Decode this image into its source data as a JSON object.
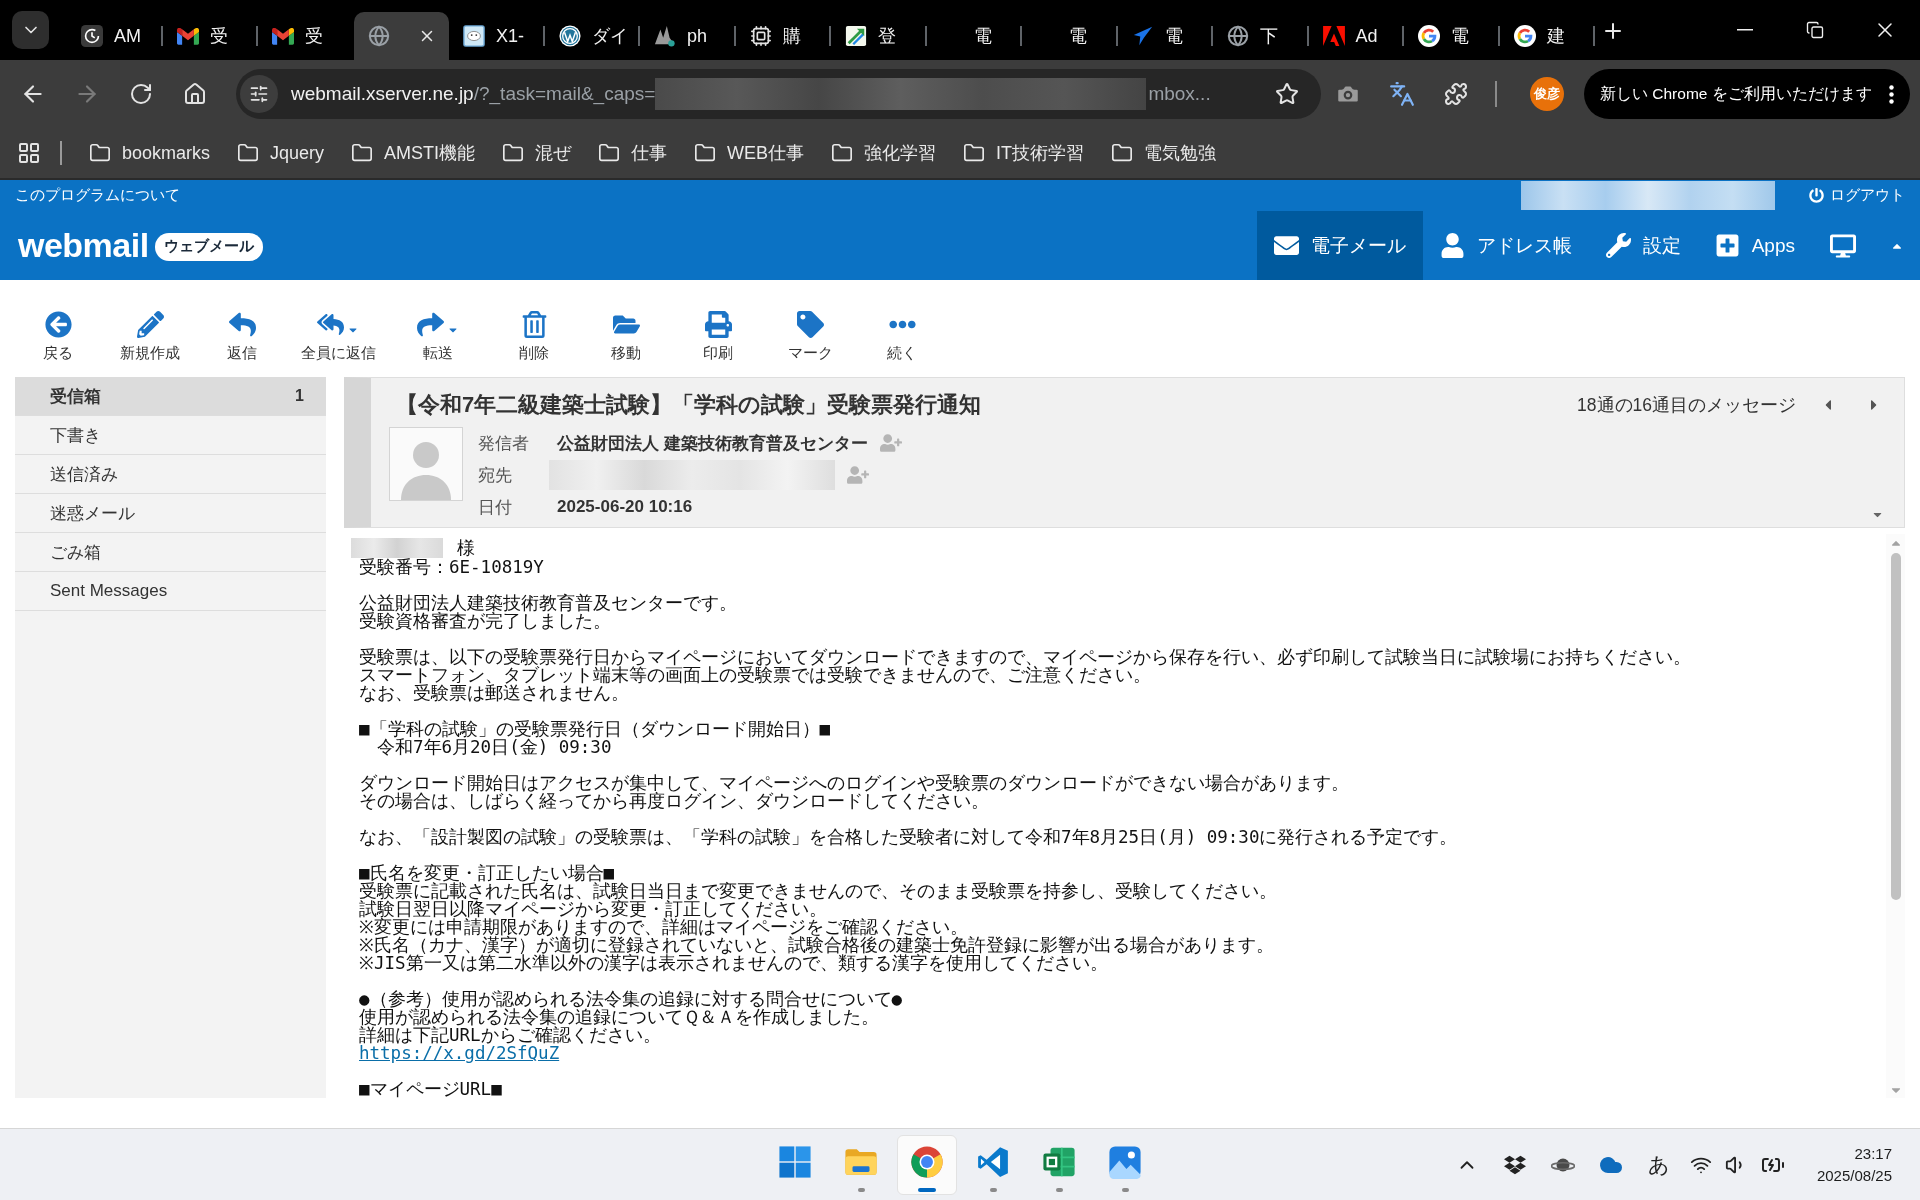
{
  "browser": {
    "tabs": [
      {
        "title": "AM",
        "selected": false
      },
      {
        "title": "受",
        "selected": false
      },
      {
        "title": "受",
        "selected": false
      },
      {
        "selected": true
      },
      {
        "title": "X1-",
        "selected": false
      },
      {
        "title": "ダイ",
        "selected": false
      },
      {
        "title": "ph",
        "selected": false
      },
      {
        "title": "購",
        "selected": false
      },
      {
        "title": "登",
        "selected": false
      },
      {
        "title": "電",
        "selected": false
      },
      {
        "title": "電",
        "selected": false
      },
      {
        "title": "電",
        "selected": false
      },
      {
        "title": "下",
        "selected": false
      },
      {
        "title": "Ad",
        "selected": false
      },
      {
        "title": "電",
        "selected": false
      },
      {
        "title": "建",
        "selected": false
      }
    ],
    "forward_button": {
      "disabled": true
    },
    "address_bar": {
      "host": "webmail.xserver.ne.jp",
      "path": "/?_task=mail&_caps=",
      "tail": "mbox..."
    },
    "profile_initials": "俊彦",
    "update_button": "新しい Chrome をご利用いただけます",
    "bookmarks": [
      "bookmarks",
      "Jquery",
      "AMSTI機能",
      "混ぜ",
      "仕事",
      "WEB仕事",
      "強化学習",
      "IT技術学習",
      "電気勉強"
    ]
  },
  "webmail": {
    "about_link": "このプログラムについて",
    "logout": "ログアウト",
    "logo": {
      "name": "webmail",
      "badge": "ウェブメール"
    },
    "nav": [
      {
        "label": "電子メール",
        "selected": true
      },
      {
        "label": "アドレス帳",
        "selected": false
      },
      {
        "label": "設定",
        "selected": false
      },
      {
        "label": "Apps",
        "selected": false
      }
    ],
    "toolbar": [
      {
        "label": "戻る",
        "dropdown": false
      },
      {
        "label": "新規作成",
        "dropdown": false
      },
      {
        "label": "返信",
        "dropdown": false
      },
      {
        "label": "全員に返信",
        "dropdown": true
      },
      {
        "label": "転送",
        "dropdown": true
      },
      {
        "label": "削除",
        "dropdown": false
      },
      {
        "label": "移動",
        "dropdown": false
      },
      {
        "label": "印刷",
        "dropdown": false
      },
      {
        "label": "マーク",
        "dropdown": false
      },
      {
        "label": "続く",
        "dropdown": false
      }
    ],
    "folders": [
      {
        "name": "受信箱",
        "count": "1",
        "selected": true
      },
      {
        "name": "下書き",
        "selected": false
      },
      {
        "name": "送信済み",
        "selected": false
      },
      {
        "name": "迷惑メール",
        "selected": false
      },
      {
        "name": "ごみ箱",
        "selected": false
      },
      {
        "name": "Sent Messages",
        "selected": false
      }
    ],
    "message": {
      "subject": "【令和7年二級建築士試験】「学科の試験」受験票発行通知",
      "position": "18通の16通目のメッセージ",
      "from": {
        "label": "発信者",
        "value": "公益財団法人 建築技術教育普及センター"
      },
      "to": {
        "label": "宛先"
      },
      "date": {
        "label": "日付",
        "value": "2025-06-20 10:16"
      },
      "body": {
        "salutation": "様",
        "paragraphs": [
          {
            "lines": [
              "受験番号：6E-10819Y"
            ]
          },
          {
            "lines": [
              "公益財団法人建築技術教育普及センターです。",
              "受験資格審査が完了しました。"
            ]
          },
          {
            "lines": [
              "受験票は、以下の受験票発行日からマイページにおいてダウンロードできますので、マイページから保存を行い、必ず印刷して試験当日に試験場にお持ちください。",
              "スマートフォン、タブレット端末等の画面上の受験票では受験できませんので、ご注意ください。",
              "なお、受験票は郵送されません。"
            ]
          },
          {
            "lines": [
              "■「学科の試験」の受験票発行日（ダウンロード開始日）■",
              "　令和7年6月20日(金) 09:30"
            ]
          },
          {
            "lines": [
              "ダウンロード開始日はアクセスが集中して、マイページへのログインや受験票のダウンロードができない場合があります。",
              "その場合は、しばらく経ってから再度ログイン、ダウンロードしてください。"
            ]
          },
          {
            "lines": [
              "なお、「設計製図の試験」の受験票は、「学科の試験」を合格した受験者に対して令和7年8月25日(月) 09:30に発行される予定です。"
            ]
          },
          {
            "lines": [
              "■氏名を変更・訂正したい場合■",
              "受験票に記載された氏名は、試験日当日まで変更できませんので、そのまま受験票を持参し、受験してください。",
              "試験日翌日以降マイページから変更・訂正してください。",
              "※変更には申請期限がありますので、詳細はマイページをご確認ください。",
              "※氏名（カナ、漢字）が適切に登録されていないと、試験合格後の建築士免許登録に影響が出る場合があります。",
              "※JIS第一又は第二水準以外の漢字は表示されませんので、類する漢字を使用してください。"
            ]
          },
          {
            "lines": [
              "●（参考）使用が認められる法令集の追録に対する問合せについて●",
              "使用が認められる法令集の追録についてＱ＆Ａを作成しました。",
              "詳細は下記URLからご確認ください。"
            ],
            "link": "https://x.gd/2SfQuZ"
          },
          {
            "lines": [
              "■マイページURL■"
            ]
          }
        ]
      }
    }
  },
  "taskbar": {
    "apps": [
      {
        "selected": false,
        "running": false
      },
      {
        "selected": false,
        "running": true
      },
      {
        "selected": true,
        "running": true
      },
      {
        "selected": false,
        "running": true
      },
      {
        "selected": false,
        "running": true
      },
      {
        "selected": false,
        "running": true
      }
    ],
    "ime": "あ",
    "time": "23:17",
    "date": "2025/08/25"
  }
}
